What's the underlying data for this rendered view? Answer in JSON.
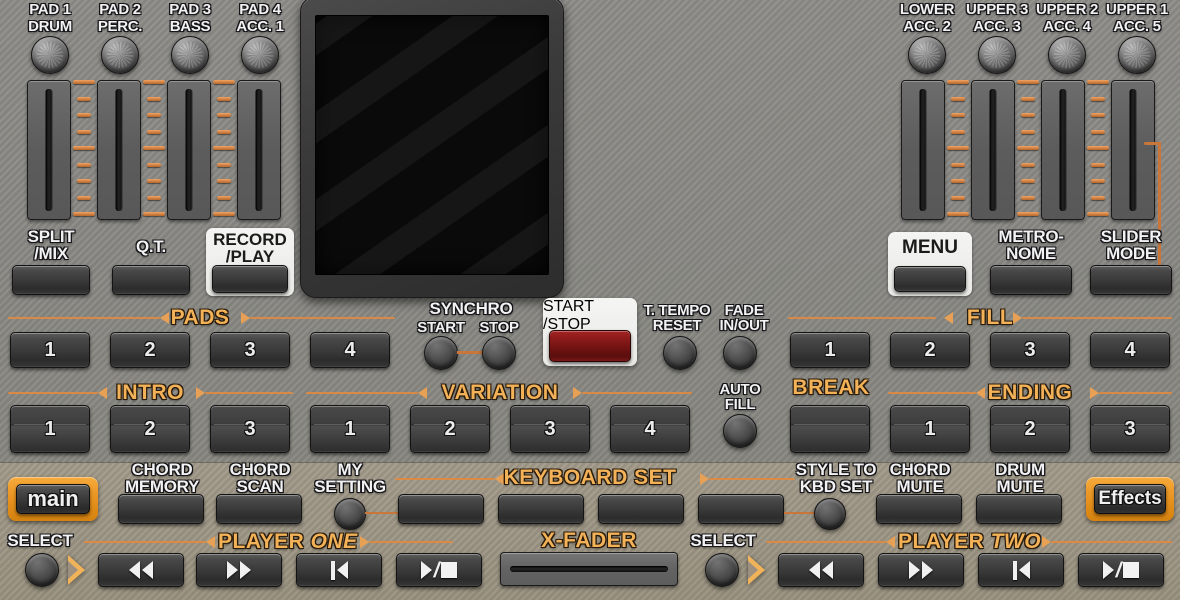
{
  "device": {
    "name": "arranger-keyboard-control-panel",
    "accent_color": "#e8a055",
    "panel_color": "#8a8984",
    "bottom_strip_color": "#9d9685",
    "record_active_color": "#8e1b1b"
  },
  "display": {
    "label": "main-display",
    "content": ""
  },
  "left_sliders": [
    {
      "top": "PAD 1",
      "bottom": "DRUM"
    },
    {
      "top": "PAD 2",
      "bottom": "PERC."
    },
    {
      "top": "PAD 3",
      "bottom": "BASS"
    },
    {
      "top": "PAD 4",
      "bottom": "ACC. 1"
    }
  ],
  "right_sliders": [
    {
      "top": "LOWER",
      "bottom": "ACC. 2"
    },
    {
      "top": "UPPER 3",
      "bottom": "ACC. 3"
    },
    {
      "top": "UPPER 2",
      "bottom": "ACC. 4"
    },
    {
      "top": "UPPER 1",
      "bottom": "ACC. 5"
    }
  ],
  "left_function_buttons": [
    {
      "label": "SPLIT\n/MIX",
      "highlighted": false
    },
    {
      "label": "Q.T.",
      "highlighted": false
    },
    {
      "label": "RECORD\n/PLAY",
      "highlighted": true
    }
  ],
  "right_function_buttons": [
    {
      "label": "MENU",
      "highlighted": true
    },
    {
      "label": "METRO-\nNOME",
      "highlighted": false
    },
    {
      "label": "SLIDER\nMODE",
      "highlighted": false
    }
  ],
  "sections": {
    "pads": {
      "title": "PADS",
      "buttons": [
        "1",
        "2",
        "3",
        "4"
      ]
    },
    "intro": {
      "title": "INTRO",
      "buttons": [
        "1",
        "2",
        "3"
      ]
    },
    "variation": {
      "title": "VARIATION",
      "buttons": [
        "1",
        "2",
        "3",
        "4"
      ]
    },
    "fill": {
      "title": "FILL",
      "buttons": [
        "1",
        "2",
        "3",
        "4"
      ]
    },
    "ending": {
      "title": "ENDING",
      "buttons": [
        "1",
        "2",
        "3"
      ]
    },
    "break": {
      "title": "BREAK",
      "buttons": [
        ""
      ]
    },
    "keyboard_set": {
      "title": "KEYBOARD SET",
      "buttons": [
        "",
        "",
        "",
        ""
      ]
    }
  },
  "transport": {
    "synchro_title": "SYNCHRO",
    "synchro_start": "START",
    "synchro_stop": "STOP",
    "start_stop": "START\n/STOP",
    "tap_tempo": "T. TEMPO\nRESET",
    "fade": "FADE\nIN/OUT",
    "auto_fill": "AUTO\nFILL"
  },
  "bottom_row": {
    "main_button": "main",
    "effects_button": "Effects",
    "chord_memory": "CHORD\nMEMORY",
    "chord_scan": "CHORD\nSCAN",
    "my_setting": "MY\nSETTING",
    "style_to_kbd_set": "STYLE TO\nKBD SET",
    "chord_mute": "CHORD\nMUTE",
    "drum_mute": "DRUM\nMUTE"
  },
  "players": {
    "select_label": "SELECT",
    "player_one": {
      "word1": "PLAYER",
      "word2": "ONE"
    },
    "player_two": {
      "word1": "PLAYER",
      "word2": "TWO"
    },
    "buttons": [
      "rewind-icon",
      "fast-forward-icon",
      "previous-track-icon",
      "play-stop-icon"
    ]
  },
  "xfader": {
    "title": "X-FADER"
  }
}
